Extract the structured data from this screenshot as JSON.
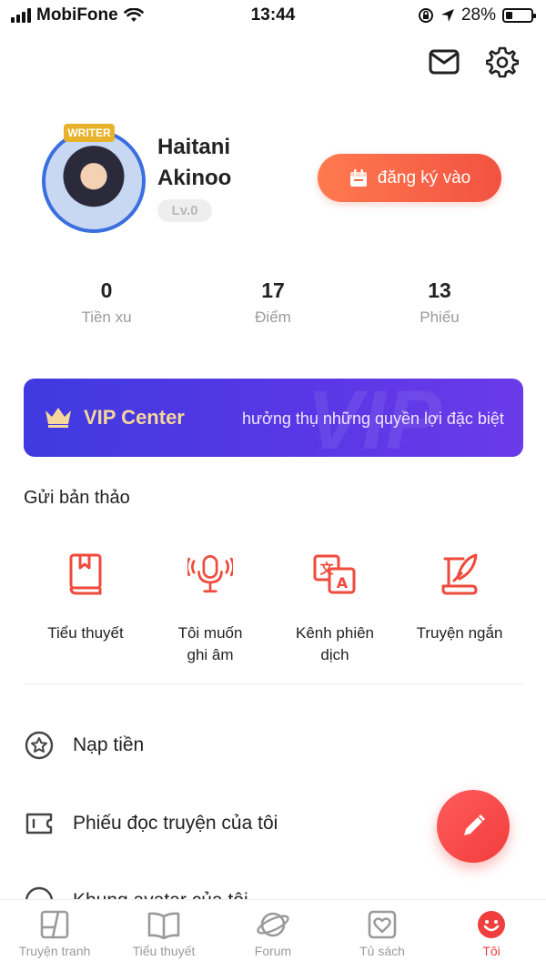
{
  "status_bar": {
    "carrier": "MobiFone",
    "time": "13:44",
    "battery_percent": "28%",
    "battery_level": 0.28
  },
  "profile": {
    "avatar_badge": "WRITER",
    "name": "Haitani Akinoo",
    "level": "Lv.0",
    "checkin_label": "đăng ký vào"
  },
  "stats": [
    {
      "value": "0",
      "label": "Tiền xu"
    },
    {
      "value": "17",
      "label": "Điểm"
    },
    {
      "value": "13",
      "label": "Phiếu"
    }
  ],
  "vip": {
    "title": "VIP Center",
    "subtitle": "hưởng thụ những quyền lợi đặc biệt",
    "watermark": "VIP"
  },
  "submit_section": {
    "title": "Gửi bản thảo",
    "items": [
      {
        "label": "Tiểu thuyết",
        "icon": "book-icon"
      },
      {
        "label": "Tôi muốn ghi âm",
        "icon": "microphone-icon"
      },
      {
        "label": "Kênh phiên dịch",
        "icon": "translate-icon"
      },
      {
        "label": "Truyện ngắn",
        "icon": "quill-icon"
      }
    ]
  },
  "menu": [
    {
      "label": "Nạp tiền",
      "icon": "star-circle-icon"
    },
    {
      "label": "Phiếu đọc truyện của tôi",
      "icon": "ticket-icon"
    },
    {
      "label": "Khung avatar của tôi",
      "icon": "avatar-frame-icon"
    }
  ],
  "tabs": [
    {
      "label": "Truyện tranh",
      "icon": "comic-icon"
    },
    {
      "label": "Tiểu thuyết",
      "icon": "open-book-icon"
    },
    {
      "label": "Forum",
      "icon": "planet-icon"
    },
    {
      "label": "Tủ sách",
      "icon": "heart-box-icon"
    },
    {
      "label": "Tôi",
      "icon": "smiley-icon",
      "active": true
    }
  ],
  "colors": {
    "accent": "#f24a3f",
    "vip_gradient_start": "#3f3ae0",
    "vip_gradient_end": "#6a3be8",
    "vip_title": "#f5d79a"
  }
}
